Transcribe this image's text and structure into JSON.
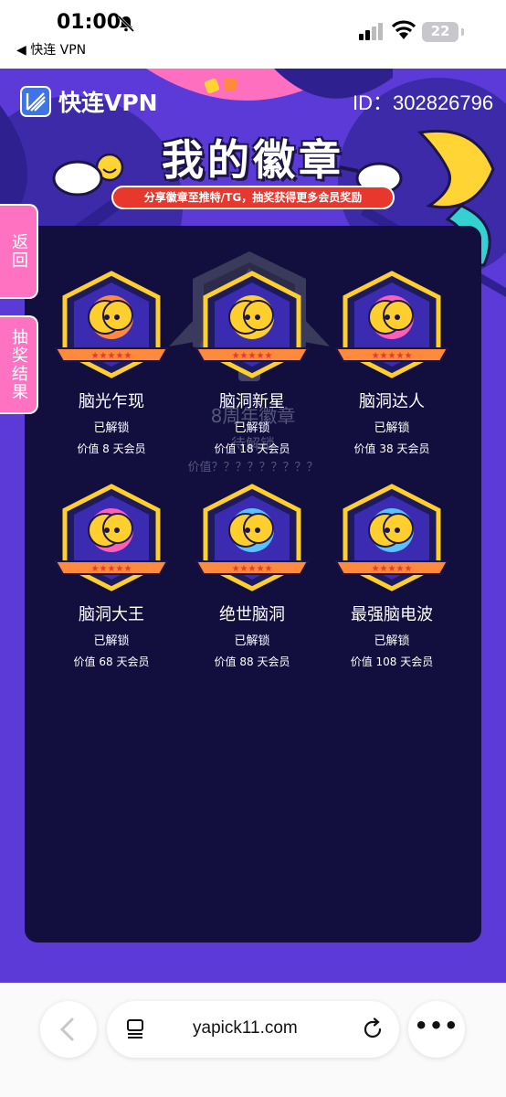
{
  "status_bar": {
    "time": "01:00",
    "back_app": "◀ 快连 VPN",
    "battery": "22"
  },
  "header": {
    "brand": "快连VPN",
    "user_id": "ID：302826796",
    "title": "我的徽章",
    "subtitle": "分享徽章至推特/TG，抽奖获得更多会员奖励"
  },
  "side_tabs": {
    "back": "返回",
    "lottery": "抽奖结果"
  },
  "featured_badge": {
    "name": "8周年徽章",
    "status": "待解锁",
    "value": "价值？？？？？？？？？"
  },
  "badges": [
    {
      "name": "脑光乍现",
      "status": "已解锁",
      "value": "价值 8 天会员",
      "color": "#ff8a3d"
    },
    {
      "name": "脑洞新星",
      "status": "已解锁",
      "value": "价值 18 天会员",
      "color": "#ffcf2e"
    },
    {
      "name": "脑洞达人",
      "status": "已解锁",
      "value": "价值 38 天会员",
      "color": "#ff5fb8"
    },
    {
      "name": "脑洞大王",
      "status": "已解锁",
      "value": "价值 68 天会员",
      "color": "#ff5fb8"
    },
    {
      "name": "绝世脑洞",
      "status": "已解锁",
      "value": "价值 88 天会员",
      "color": "#58c3ff"
    },
    {
      "name": "最强脑电波",
      "status": "已解锁",
      "value": "价值 108 天会员",
      "color": "#58c3ff"
    }
  ],
  "browser": {
    "url": "yapick11.com",
    "more": "•••"
  },
  "colors": {
    "page_bg": "#5b3ad8",
    "panel_bg": "#120f3e",
    "side_tab": "#ff72c2",
    "ribbon": "#e8382e"
  }
}
